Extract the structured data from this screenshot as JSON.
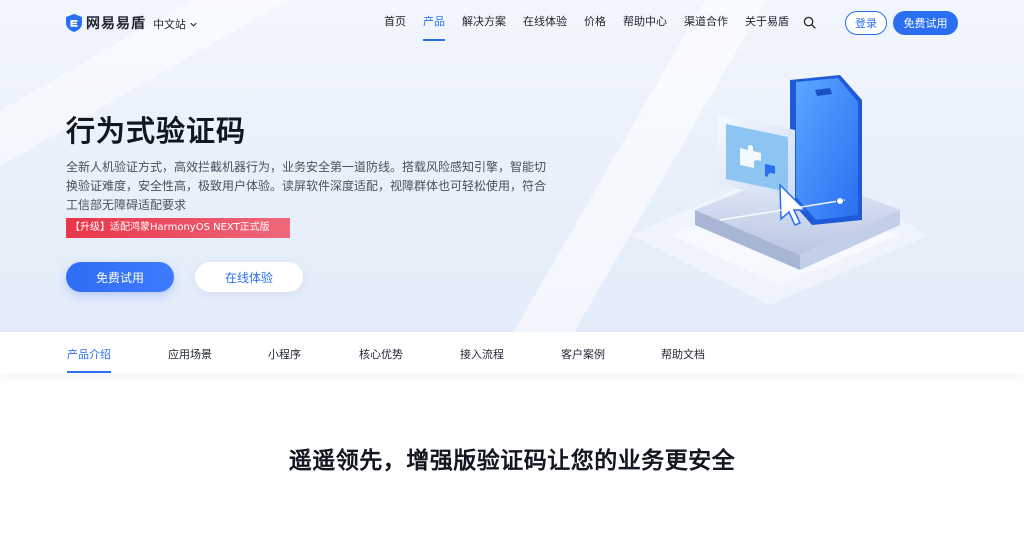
{
  "header": {
    "logo_text": "网易易盾",
    "site_switch": "中文站",
    "nav": [
      {
        "label": "首页",
        "active": false
      },
      {
        "label": "产品",
        "active": true
      },
      {
        "label": "解决方案",
        "active": false
      },
      {
        "label": "在线体验",
        "active": false
      },
      {
        "label": "价格",
        "active": false
      },
      {
        "label": "帮助中心",
        "active": false
      },
      {
        "label": "渠道合作",
        "active": false
      },
      {
        "label": "关于易盾",
        "active": false
      }
    ],
    "login_label": "登录",
    "trial_label": "免费试用"
  },
  "hero": {
    "title": "行为式验证码",
    "description": "全新人机验证方式，高效拦截机器行为，业务安全第一道防线。搭载风险感知引擎，智能切换验证难度，安全性高，极致用户体验。读屏软件深度适配，视障群体也可轻松使用，符合工信部无障碍适配要求",
    "badge": "【升级】适配鸿蒙HarmonyOS NEXT正式版",
    "cta_primary": "免费试用",
    "cta_secondary": "在线体验"
  },
  "subnav": {
    "items": [
      {
        "label": "产品介绍",
        "active": true
      },
      {
        "label": "应用场景",
        "active": false
      },
      {
        "label": "小程序",
        "active": false
      },
      {
        "label": "核心优势",
        "active": false
      },
      {
        "label": "接入流程",
        "active": false
      },
      {
        "label": "客户案例",
        "active": false
      },
      {
        "label": "帮助文档",
        "active": false
      }
    ]
  },
  "section": {
    "title": "遥遥领先，增强版验证码让您的业务更安全"
  },
  "colors": {
    "brand": "#2a6ff2",
    "badge": "#e8354a",
    "text_dark": "#121620"
  }
}
